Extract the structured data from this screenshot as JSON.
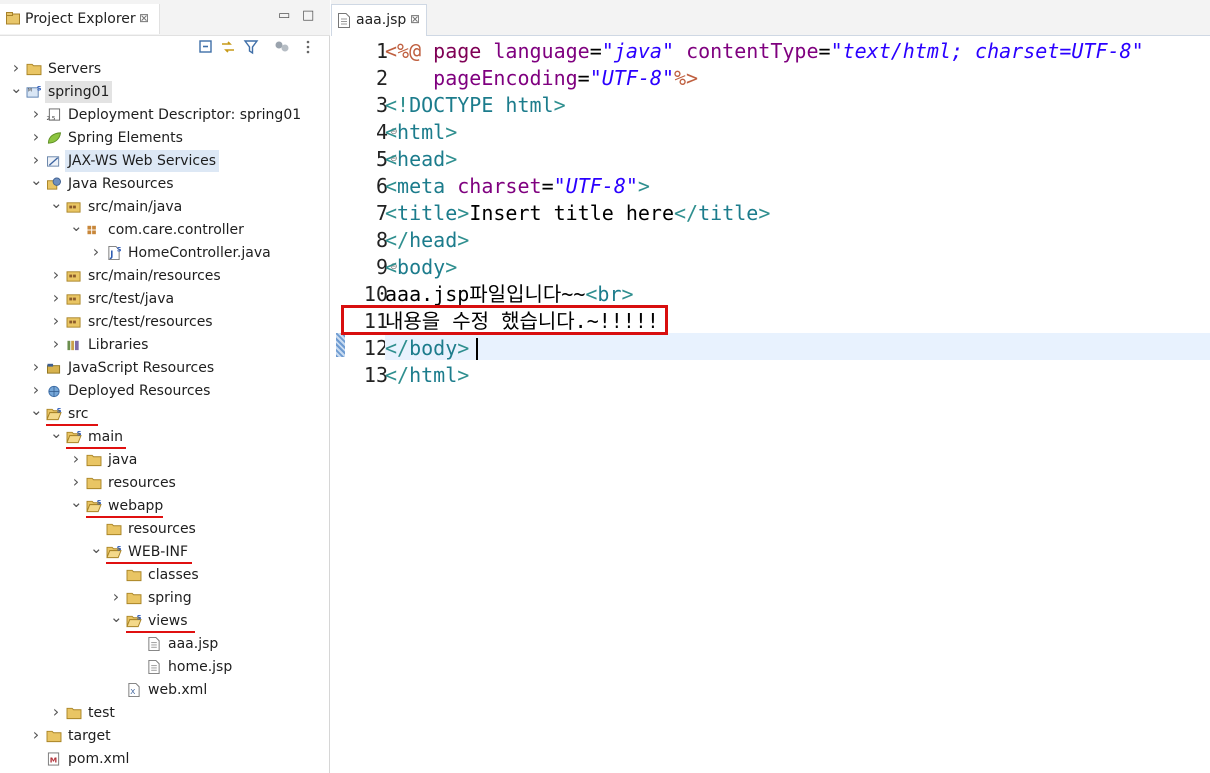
{
  "explorer": {
    "title": "Project Explorer",
    "close_glyph": "⊠",
    "minimize_glyph": "▭",
    "maximize_glyph": "□",
    "tree": [
      {
        "label": "Servers",
        "chev": ">",
        "icon": "folder-icon",
        "level": 0
      },
      {
        "label": "spring01",
        "chev": "v",
        "icon": "project-icon",
        "level": 0,
        "selected": true
      },
      {
        "label": "Deployment Descriptor: spring01",
        "chev": ">",
        "icon": "deployment-descriptor-icon",
        "level": 1
      },
      {
        "label": "Spring Elements",
        "chev": ">",
        "icon": "spring-leaf-icon",
        "level": 1
      },
      {
        "label": "JAX-WS Web Services",
        "chev": ">",
        "icon": "web-services-icon",
        "level": 1,
        "hover": true
      },
      {
        "label": "Java Resources",
        "chev": "v",
        "icon": "java-resources-icon",
        "level": 1
      },
      {
        "label": "src/main/java",
        "chev": "v",
        "icon": "source-folder-icon",
        "level": 2
      },
      {
        "label": "com.care.controller",
        "chev": "v",
        "icon": "package-icon",
        "level": 3
      },
      {
        "label": "HomeController.java",
        "chev": ">",
        "icon": "java-file-icon",
        "level": 4
      },
      {
        "label": "src/main/resources",
        "chev": ">",
        "icon": "source-folder-icon",
        "level": 2
      },
      {
        "label": "src/test/java",
        "chev": ">",
        "icon": "source-folder-icon",
        "level": 2
      },
      {
        "label": "src/test/resources",
        "chev": ">",
        "icon": "source-folder-icon",
        "level": 2
      },
      {
        "label": "Libraries",
        "chev": ">",
        "icon": "libraries-icon",
        "level": 2
      },
      {
        "label": "JavaScript Resources",
        "chev": ">",
        "icon": "javascript-resources-icon",
        "level": 1
      },
      {
        "label": "Deployed Resources",
        "chev": ">",
        "icon": "deployed-resources-icon",
        "level": 1
      },
      {
        "label": "src",
        "chev": "v",
        "icon": "folder-open-icon",
        "level": 1,
        "underline": true
      },
      {
        "label": "main",
        "chev": "v",
        "icon": "folder-open-icon",
        "level": 2,
        "underline": true
      },
      {
        "label": "java",
        "chev": ">",
        "icon": "folder-icon",
        "level": 3
      },
      {
        "label": "resources",
        "chev": ">",
        "icon": "folder-icon",
        "level": 3
      },
      {
        "label": "webapp",
        "chev": "v",
        "icon": "folder-open-icon",
        "level": 3,
        "underline": true
      },
      {
        "label": "resources",
        "chev": "",
        "icon": "folder-icon",
        "level": 4
      },
      {
        "label": "WEB-INF",
        "chev": "v",
        "icon": "folder-open-icon",
        "level": 4,
        "underline": true
      },
      {
        "label": "classes",
        "chev": "",
        "icon": "folder-icon",
        "level": 5
      },
      {
        "label": "spring",
        "chev": ">",
        "icon": "folder-icon",
        "level": 5
      },
      {
        "label": "views",
        "chev": "v",
        "icon": "folder-open-icon",
        "level": 5,
        "underline": true
      },
      {
        "label": "aaa.jsp",
        "chev": "",
        "icon": "jsp-file-icon",
        "level": 6
      },
      {
        "label": "home.jsp",
        "chev": "",
        "icon": "jsp-file-icon",
        "level": 6
      },
      {
        "label": "web.xml",
        "chev": "",
        "icon": "xml-file-icon",
        "level": 5
      },
      {
        "label": "test",
        "chev": ">",
        "icon": "folder-icon",
        "level": 2
      },
      {
        "label": "target",
        "chev": ">",
        "icon": "folder-icon",
        "level": 1
      },
      {
        "label": "pom.xml",
        "chev": "",
        "icon": "maven-pom-icon",
        "level": 1
      }
    ]
  },
  "editor": {
    "tab_label": "aaa.jsp",
    "close_glyph": "⊠",
    "lines": [
      {
        "no": "1",
        "fold": "",
        "tokens": [
          [
            "jsp",
            "<%@ "
          ],
          [
            "kw",
            "page "
          ],
          [
            "attr",
            "language"
          ],
          [
            "txt",
            "="
          ],
          [
            "str",
            "\"java\""
          ],
          [
            "txt",
            " "
          ],
          [
            "attr",
            "contentType"
          ],
          [
            "txt",
            "="
          ],
          [
            "str",
            "\"text/html; charset=UTF-8\""
          ]
        ]
      },
      {
        "no": "2",
        "fold": "",
        "tokens": [
          [
            "txt",
            "    "
          ],
          [
            "attr",
            "pageEncoding"
          ],
          [
            "txt",
            "="
          ],
          [
            "str",
            "\"UTF-8\""
          ],
          [
            "jsp",
            "%>"
          ]
        ]
      },
      {
        "no": "3",
        "fold": "",
        "tokens": [
          [
            "br",
            "<!"
          ],
          [
            "tag",
            "DOCTYPE "
          ],
          [
            "tag",
            "html"
          ],
          [
            "br",
            ">"
          ]
        ]
      },
      {
        "no": "4",
        "fold": "⊖",
        "tokens": [
          [
            "br",
            "<"
          ],
          [
            "tag",
            "html"
          ],
          [
            "br",
            ">"
          ]
        ]
      },
      {
        "no": "5",
        "fold": "⊖",
        "tokens": [
          [
            "br",
            "<"
          ],
          [
            "tag",
            "head"
          ],
          [
            "br",
            ">"
          ]
        ]
      },
      {
        "no": "6",
        "fold": "",
        "tokens": [
          [
            "br",
            "<"
          ],
          [
            "tag",
            "meta "
          ],
          [
            "attr",
            "charset"
          ],
          [
            "txt",
            "="
          ],
          [
            "str",
            "\"UTF-8\""
          ],
          [
            "br",
            ">"
          ]
        ]
      },
      {
        "no": "7",
        "fold": "",
        "tokens": [
          [
            "br",
            "<"
          ],
          [
            "tag",
            "title"
          ],
          [
            "br",
            ">"
          ],
          [
            "txt",
            "Insert title here"
          ],
          [
            "br",
            "</"
          ],
          [
            "tag",
            "title"
          ],
          [
            "br",
            ">"
          ]
        ]
      },
      {
        "no": "8",
        "fold": "",
        "tokens": [
          [
            "br",
            "</"
          ],
          [
            "tag",
            "head"
          ],
          [
            "br",
            ">"
          ]
        ]
      },
      {
        "no": "9",
        "fold": "⊖",
        "tokens": [
          [
            "br",
            "<"
          ],
          [
            "tag",
            "body"
          ],
          [
            "br",
            ">"
          ]
        ]
      },
      {
        "no": "10",
        "fold": "",
        "tokens": [
          [
            "txt",
            "aaa.jsp파일입니다~~"
          ],
          [
            "br",
            "<"
          ],
          [
            "tag",
            "br"
          ],
          [
            "br",
            ">"
          ]
        ]
      },
      {
        "no": "11",
        "fold": "",
        "tokens": [
          [
            "txt",
            "내용을 수정 했습니다.~!!!!!"
          ]
        ]
      },
      {
        "no": "12",
        "fold": "",
        "tokens": [
          [
            "br",
            "</"
          ],
          [
            "tag",
            "body"
          ],
          [
            "br",
            ">"
          ]
        ]
      },
      {
        "no": "13",
        "fold": "",
        "tokens": [
          [
            "br",
            "</"
          ],
          [
            "tag",
            "html"
          ],
          [
            "br",
            ">"
          ]
        ]
      }
    ]
  }
}
